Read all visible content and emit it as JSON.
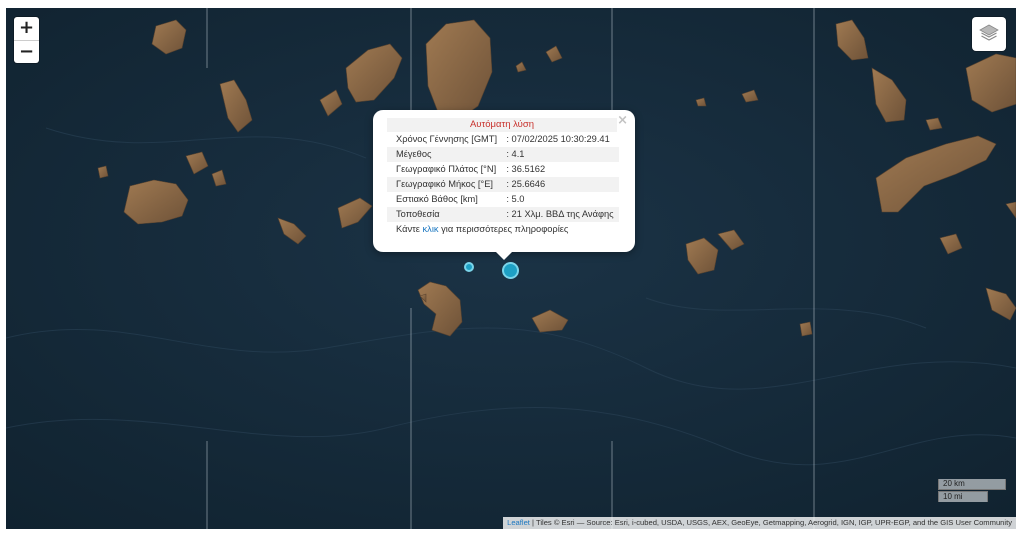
{
  "map": {
    "zoom_in_label": "+",
    "zoom_out_label": "−",
    "layers_icon": "layers-icon"
  },
  "popup": {
    "close_label": "×",
    "title": "Αυτόματη λύση",
    "rows": [
      {
        "label": "Χρόνος Γέννησης [GMT]",
        "value": ": 07/02/2025 10:30:29.41"
      },
      {
        "label": "Μέγεθος",
        "value": ": 4.1"
      },
      {
        "label": "Γεωγραφικό Πλάτος [°N]",
        "value": ": 36.5162"
      },
      {
        "label": "Γεωγραφικό Μήκος [°E]",
        "value": ": 25.6646"
      },
      {
        "label": "Εστιακό Βάθος [km]",
        "value": ": 5.0"
      },
      {
        "label": "Τοποθεσία",
        "value": ": 21 Χλμ. ΒΒΔ της Ανάφης"
      }
    ],
    "more_prefix": "Κάντε ",
    "more_link": "κλικ",
    "more_suffix": " για περισσότερες πληροφορίες"
  },
  "scale": {
    "km_label": "20 km",
    "mi_label": "10 mi"
  },
  "attribution": {
    "leaflet_link": "Leaflet",
    "text": " | Tiles © Esri — Source: Esri, i-cubed, USDA, USGS, AEX, GeoEye, Getmapping, Aerogrid, IGN, IGP, UPR-EGP, and the GIS User Community"
  },
  "colors": {
    "sea": "#14283a",
    "land": "#8a6a4a",
    "marker": "#1ea0c4",
    "title_red": "#c8312c",
    "link_blue": "#1d78c1"
  }
}
